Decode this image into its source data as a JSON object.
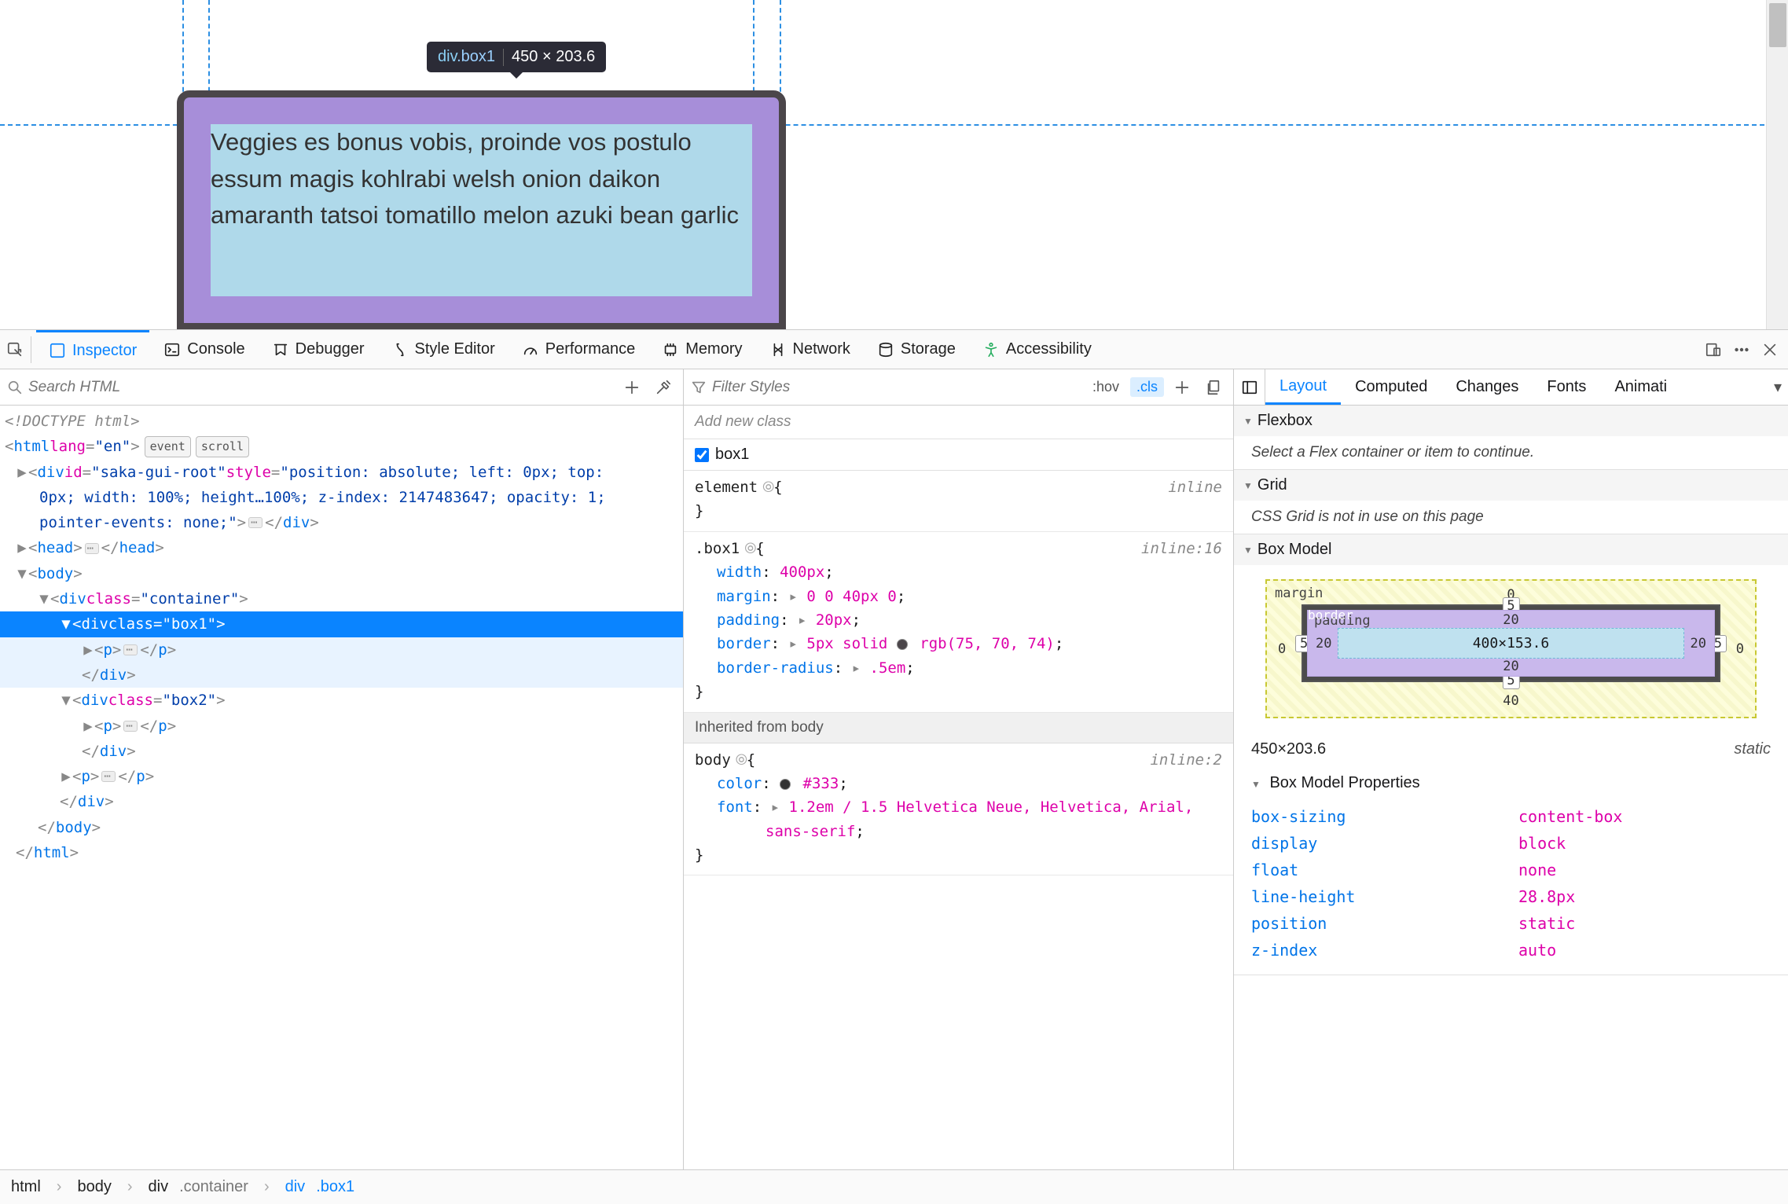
{
  "preview": {
    "tooltip_tag": "div",
    "tooltip_class": ".box1",
    "tooltip_dims": "450 × 203.6",
    "box_text": "Veggies es bonus vobis, proinde vos postulo essum magis kohlrabi welsh onion daikon amaranth tatsoi tomatillo melon azuki bean garlic"
  },
  "toolbar": {
    "inspector": "Inspector",
    "console": "Console",
    "debugger": "Debugger",
    "style_editor": "Style Editor",
    "performance": "Performance",
    "memory": "Memory",
    "network": "Network",
    "storage": "Storage",
    "accessibility": "Accessibility"
  },
  "dom_search_placeholder": "Search HTML",
  "dom": {
    "doctype": "<!DOCTYPE html>",
    "html_attrs": "lang=\"en\"",
    "badge_event": "event",
    "badge_scroll": "scroll",
    "saka1": "id=\"saka-gui-root\"",
    "saka2": "style=\"position: absolute; left: 0px; top: 0px; width: 100%; height…100%; z-index: 2147483647; opacity: 1; pointer-events: none;\"",
    "container_attr": "class=\"container\"",
    "box1_attr": "class=\"box1\"",
    "box2_attr": "class=\"box2\""
  },
  "styles": {
    "filter_placeholder": "Filter Styles",
    "hov": ":hov",
    "cls": ".cls",
    "add_new_class": "Add new class",
    "box1_checkbox": "box1",
    "rule_element": {
      "selector": "element",
      "loc": "inline"
    },
    "rule_box1": {
      "selector": ".box1",
      "loc": "inline:16",
      "decls": [
        {
          "p": "width",
          "v": "400px"
        },
        {
          "p": "margin",
          "v": "0 0 40px 0",
          "tri": true
        },
        {
          "p": "padding",
          "v": "20px",
          "tri": true
        },
        {
          "p": "border",
          "v": "5px solid rgb(75, 70, 74)",
          "tri": true,
          "swatch": "#4b464a"
        },
        {
          "p": "border-radius",
          "v": ".5em",
          "tri": true
        }
      ]
    },
    "inherited_label": "Inherited from body",
    "rule_body": {
      "selector": "body",
      "loc": "inline:2",
      "decls": [
        {
          "p": "color",
          "v": "#333",
          "swatch": "#333"
        },
        {
          "p": "font",
          "v": "1.2em / 1.5 Helvetica Neue, Helvetica, Arial, sans-serif",
          "tri": true
        }
      ]
    }
  },
  "right_tabs": {
    "layout": "Layout",
    "computed": "Computed",
    "changes": "Changes",
    "fonts": "Fonts",
    "anim": "Animati"
  },
  "flexbox": {
    "title": "Flexbox",
    "body": "Select a Flex container or item to continue."
  },
  "grid": {
    "title": "Grid",
    "body": "CSS Grid is not in use on this page"
  },
  "boxmodel": {
    "title": "Box Model",
    "margin": {
      "label": "margin",
      "t": "0",
      "r": "0",
      "b": "40",
      "l": "0"
    },
    "border": {
      "label": "border",
      "t": "5",
      "r": "5",
      "b": "5",
      "l": "5"
    },
    "padding": {
      "label": "padding",
      "t": "20",
      "r": "20",
      "b": "20",
      "l": "20"
    },
    "content": "400×153.6",
    "dims": "450×203.6",
    "position": "static",
    "props_title": "Box Model Properties",
    "props": [
      {
        "k": "box-sizing",
        "v": "content-box"
      },
      {
        "k": "display",
        "v": "block"
      },
      {
        "k": "float",
        "v": "none"
      },
      {
        "k": "line-height",
        "v": "28.8px"
      },
      {
        "k": "position",
        "v": "static"
      },
      {
        "k": "z-index",
        "v": "auto"
      }
    ]
  },
  "crumbs": [
    {
      "tag": "html",
      "cls": ""
    },
    {
      "tag": "body",
      "cls": ""
    },
    {
      "tag": "div",
      "cls": ".container"
    },
    {
      "tag": "div",
      "cls": ".box1",
      "active": true
    }
  ]
}
